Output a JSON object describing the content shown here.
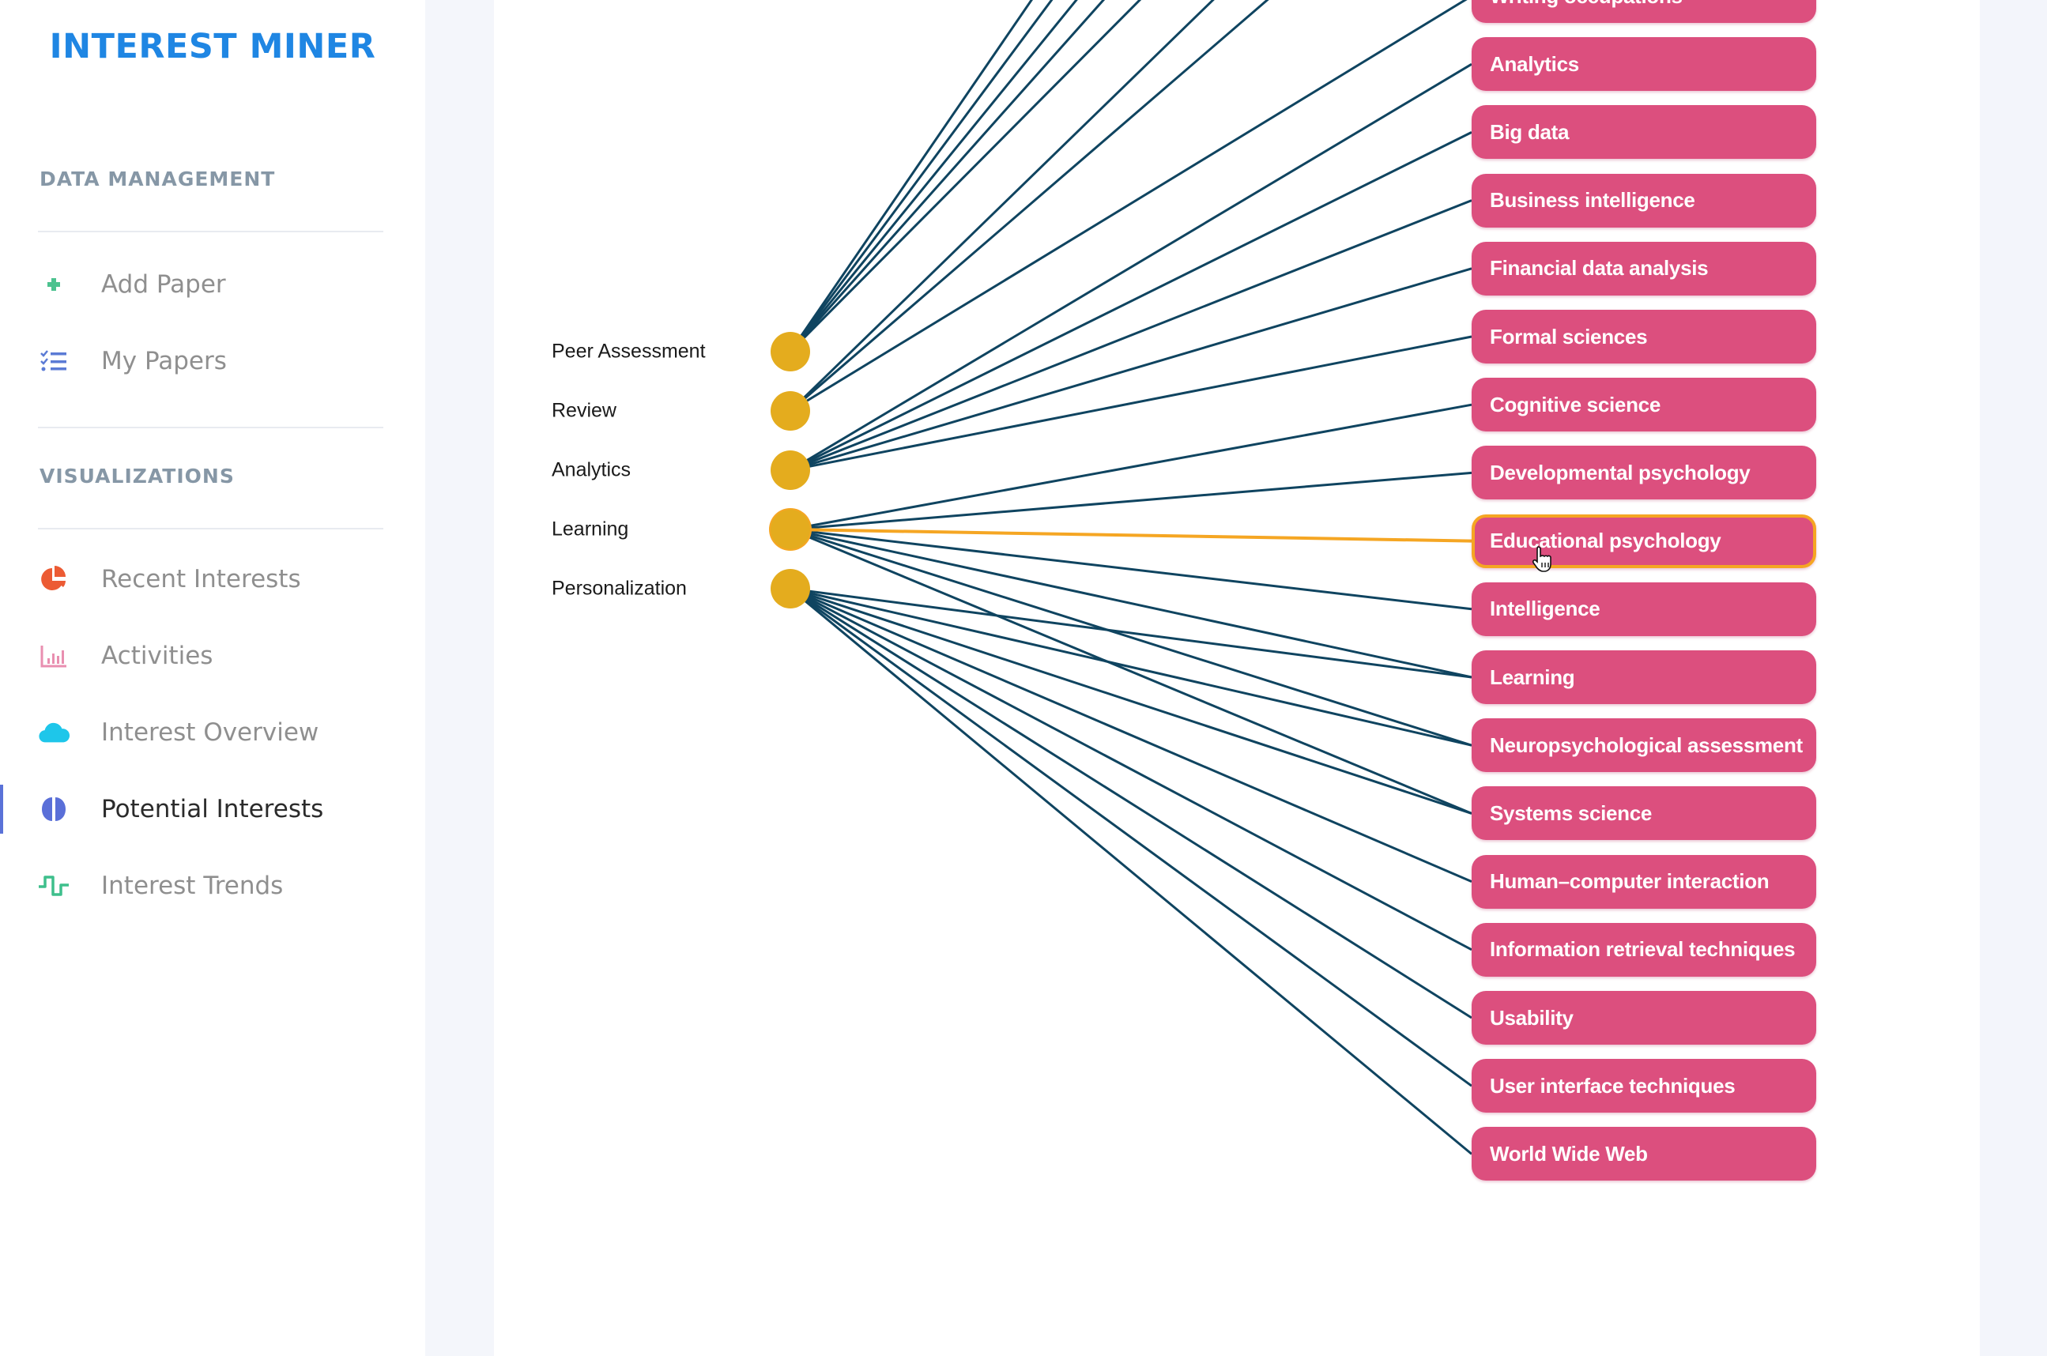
{
  "app": {
    "title": "INTEREST MINER"
  },
  "sidebar": {
    "sections": [
      {
        "title": "DATA MANAGEMENT",
        "items": [
          {
            "label": "Add Paper",
            "icon": "plus-icon",
            "color": "#4cc28f"
          },
          {
            "label": "My Papers",
            "icon": "checklist-icon",
            "color": "#5b7bd5"
          }
        ]
      },
      {
        "title": "VISUALIZATIONS",
        "items": [
          {
            "label": "Recent Interests",
            "icon": "pie-chart-icon",
            "color": "#ec5b34"
          },
          {
            "label": "Activities",
            "icon": "bar-chart-icon",
            "color": "#e98fb0"
          },
          {
            "label": "Interest Overview",
            "icon": "cloud-icon",
            "color": "#1ec6ea"
          },
          {
            "label": "Potential Interests",
            "icon": "brain-icon",
            "color": "#5a6fd8",
            "active": true
          },
          {
            "label": "Interest Trends",
            "icon": "pulse-icon",
            "color": "#3ebf8c"
          }
        ]
      }
    ]
  },
  "graph": {
    "colors": {
      "source_node": "#e4ac1e",
      "target_node": "#dc4f7e",
      "edge": "#0f4460",
      "highlight_edge": "#f5a623"
    },
    "sources": [
      "Peer Assessment",
      "Review",
      "Analytics",
      "Learning",
      "Personalization"
    ],
    "targets": [
      "Writing occupations",
      "Analytics",
      "Big data",
      "Business intelligence",
      "Financial data analysis",
      "Formal sciences",
      "Cognitive science",
      "Developmental psychology",
      "Educational psychology",
      "Intelligence",
      "Learning",
      "Neuropsychological assessment",
      "Systems science",
      "Human–computer interaction",
      "Information retrieval techniques",
      "Usability",
      "User interface techniques",
      "World Wide Web"
    ],
    "highlighted": {
      "source": "Learning",
      "target": "Educational psychology"
    },
    "edges": [
      [
        "Peer Assessment",
        "offscreen-1"
      ],
      [
        "Peer Assessment",
        "offscreen-2"
      ],
      [
        "Peer Assessment",
        "offscreen-3"
      ],
      [
        "Peer Assessment",
        "offscreen-4"
      ],
      [
        "Peer Assessment",
        "offscreen-5"
      ],
      [
        "Review",
        "offscreen-6"
      ],
      [
        "Review",
        "offscreen-7"
      ],
      [
        "Review",
        "Writing occupations"
      ],
      [
        "Analytics",
        "Analytics"
      ],
      [
        "Analytics",
        "Big data"
      ],
      [
        "Analytics",
        "Business intelligence"
      ],
      [
        "Analytics",
        "Financial data analysis"
      ],
      [
        "Analytics",
        "Formal sciences"
      ],
      [
        "Learning",
        "Cognitive science"
      ],
      [
        "Learning",
        "Developmental psychology"
      ],
      [
        "Learning",
        "Educational psychology"
      ],
      [
        "Learning",
        "Intelligence"
      ],
      [
        "Learning",
        "Learning"
      ],
      [
        "Learning",
        "Neuropsychological assessment"
      ],
      [
        "Learning",
        "Systems science"
      ],
      [
        "Personalization",
        "Neuropsychological assessment"
      ],
      [
        "Personalization",
        "Systems science"
      ],
      [
        "Personalization",
        "Human–computer interaction"
      ],
      [
        "Personalization",
        "Information retrieval techniques"
      ],
      [
        "Personalization",
        "Usability"
      ],
      [
        "Personalization",
        "User interface techniques"
      ],
      [
        "Personalization",
        "World Wide Web"
      ],
      [
        "Personalization",
        "Learning"
      ]
    ]
  }
}
